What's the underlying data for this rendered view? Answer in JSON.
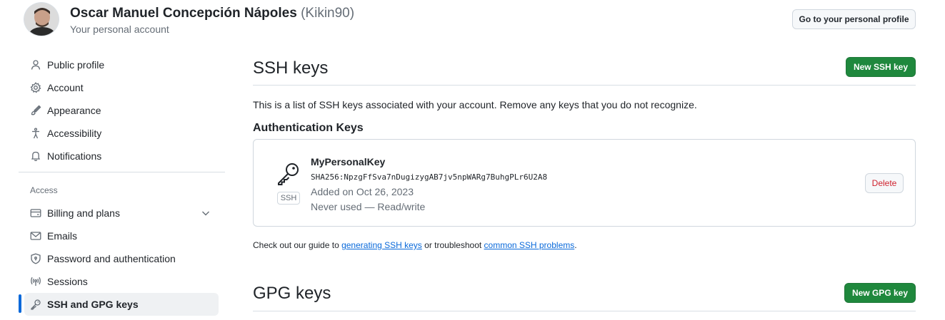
{
  "header": {
    "name": "Oscar Manuel Concepción Nápoles",
    "handle": "(Kikin90)",
    "subtitle": "Your personal account",
    "profile_button": "Go to your personal profile"
  },
  "sidebar": {
    "items": [
      {
        "label": "Public profile",
        "icon": "person-icon"
      },
      {
        "label": "Account",
        "icon": "gear-icon"
      },
      {
        "label": "Appearance",
        "icon": "paintbrush-icon"
      },
      {
        "label": "Accessibility",
        "icon": "accessibility-icon"
      },
      {
        "label": "Notifications",
        "icon": "bell-icon"
      }
    ],
    "access_heading": "Access",
    "access_items": [
      {
        "label": "Billing and plans",
        "icon": "credit-card-icon"
      },
      {
        "label": "Emails",
        "icon": "mail-icon"
      },
      {
        "label": "Password and authentication",
        "icon": "shield-lock-icon"
      },
      {
        "label": "Sessions",
        "icon": "broadcast-icon"
      },
      {
        "label": "SSH and GPG keys",
        "icon": "key-icon"
      }
    ]
  },
  "ssh": {
    "title": "SSH keys",
    "new_button": "New SSH key",
    "description": "This is a list of SSH keys associated with your account. Remove any keys that you do not recognize.",
    "auth_heading": "Authentication Keys",
    "key": {
      "badge": "SSH",
      "name": "MyPersonalKey",
      "fingerprint": "SHA256:NpzgFfSva7nDugizygAB7jv5npWARg7BuhgPLr6U2A8",
      "added": "Added on Oct 26, 2023",
      "usage": "Never used — Read/write",
      "delete_label": "Delete"
    },
    "footer": {
      "prefix": "Check out our guide to ",
      "link1": "generating SSH keys",
      "middle": " or troubleshoot ",
      "link2": "common SSH problems",
      "suffix": "."
    }
  },
  "gpg": {
    "title": "GPG keys",
    "new_button": "New GPG key"
  },
  "colors": {
    "primary_green": "#1f883d",
    "accent_blue": "#0969da",
    "danger_red": "#cf222e"
  }
}
